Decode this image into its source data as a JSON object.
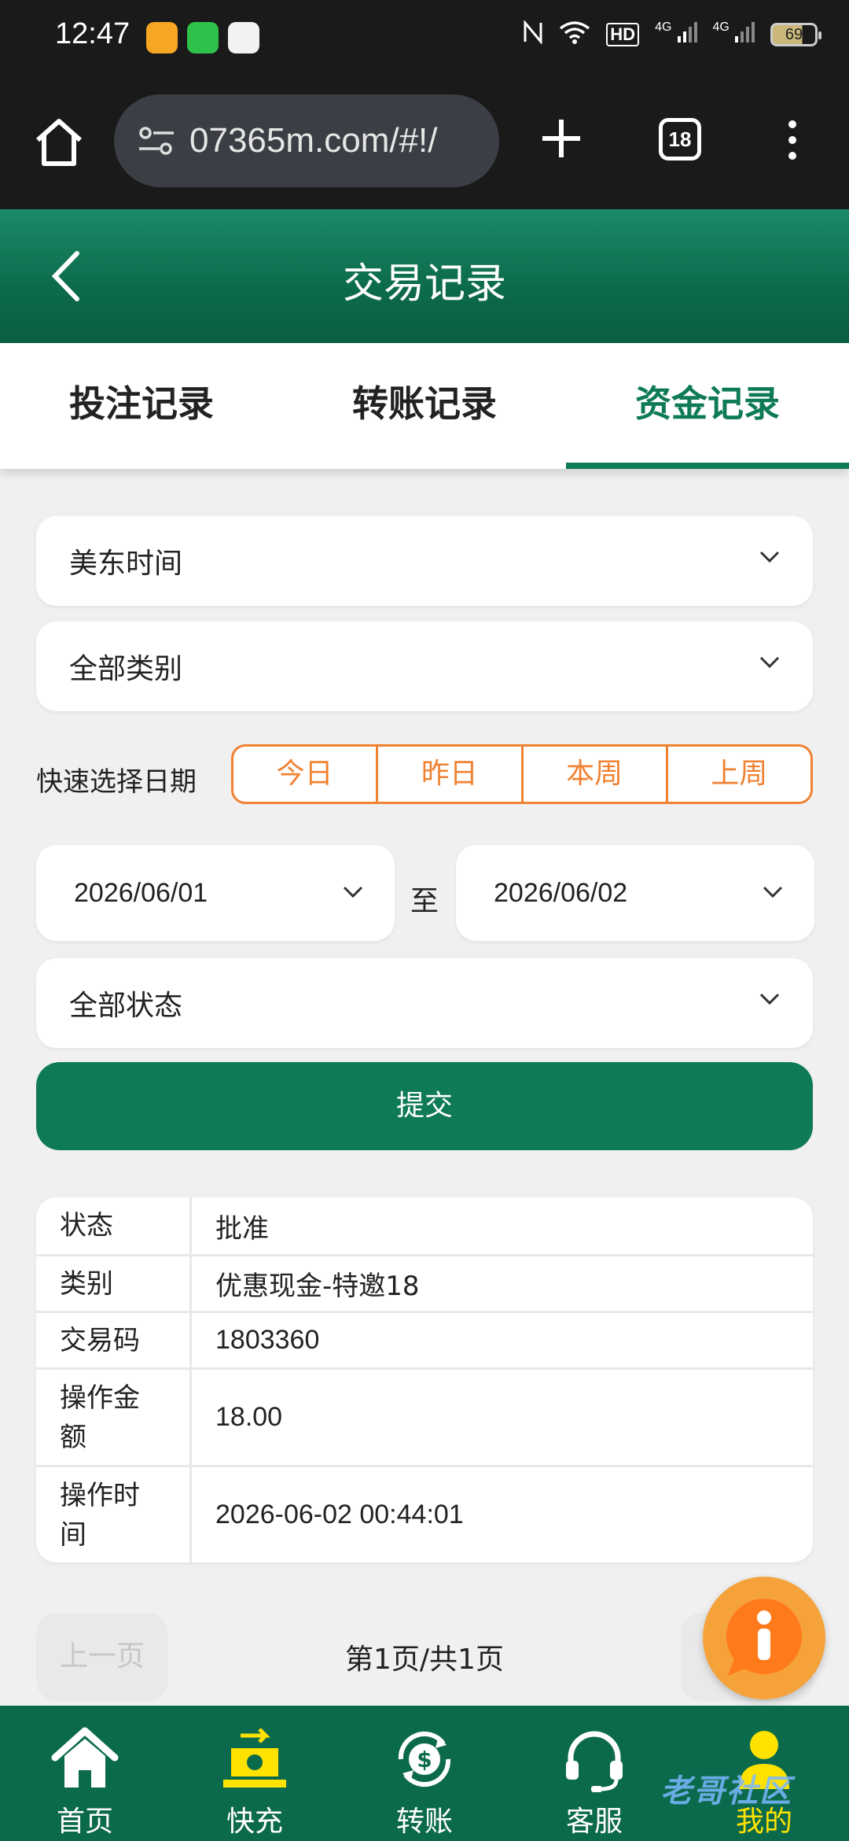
{
  "status_bar": {
    "time": "12:47",
    "network_1": "4G",
    "network_2": "4G",
    "hd_label": "HD",
    "battery": "69"
  },
  "browser": {
    "url": "07365m.com/#!/",
    "tab_count": "18"
  },
  "header": {
    "title": "交易记录"
  },
  "tabs": [
    {
      "label": "投注记录",
      "active": false
    },
    {
      "label": "转账记录",
      "active": false
    },
    {
      "label": "资金记录",
      "active": true
    }
  ],
  "filters": {
    "timezone": "美东时间",
    "category": "全部类别",
    "quick_label": "快速选择日期",
    "quick_buttons": [
      "今日",
      "昨日",
      "本周",
      "上周"
    ],
    "date_from": "2026/06/01",
    "date_to": "2026/06/02",
    "to_label": "至",
    "status": "全部状态",
    "submit_label": "提交"
  },
  "record": [
    {
      "key": "状态",
      "value": "批准"
    },
    {
      "key": "类别",
      "value": "优惠现金-特邀18"
    },
    {
      "key": "交易码",
      "value": "1803360"
    },
    {
      "key": "操作金额",
      "value": "18.00"
    },
    {
      "key": "操作时间",
      "value": "2026-06-02 00:44:01"
    }
  ],
  "pagination": {
    "prev_label": "上一页",
    "info": "第1页/共1页"
  },
  "bottom_nav": [
    {
      "label": "首页",
      "icon": "home-icon",
      "active": false
    },
    {
      "label": "快充",
      "icon": "quick-recharge-icon",
      "active": false
    },
    {
      "label": "转账",
      "icon": "transfer-icon",
      "active": false
    },
    {
      "label": "客服",
      "icon": "headset-icon",
      "active": false
    },
    {
      "label": "我的",
      "icon": "user-icon",
      "active": true
    }
  ],
  "watermark": "老哥社区",
  "colors": {
    "primary": "#0f7a58",
    "accent": "#f08232",
    "active_nav": "#ffe200",
    "float_button": "#f5a23a"
  }
}
